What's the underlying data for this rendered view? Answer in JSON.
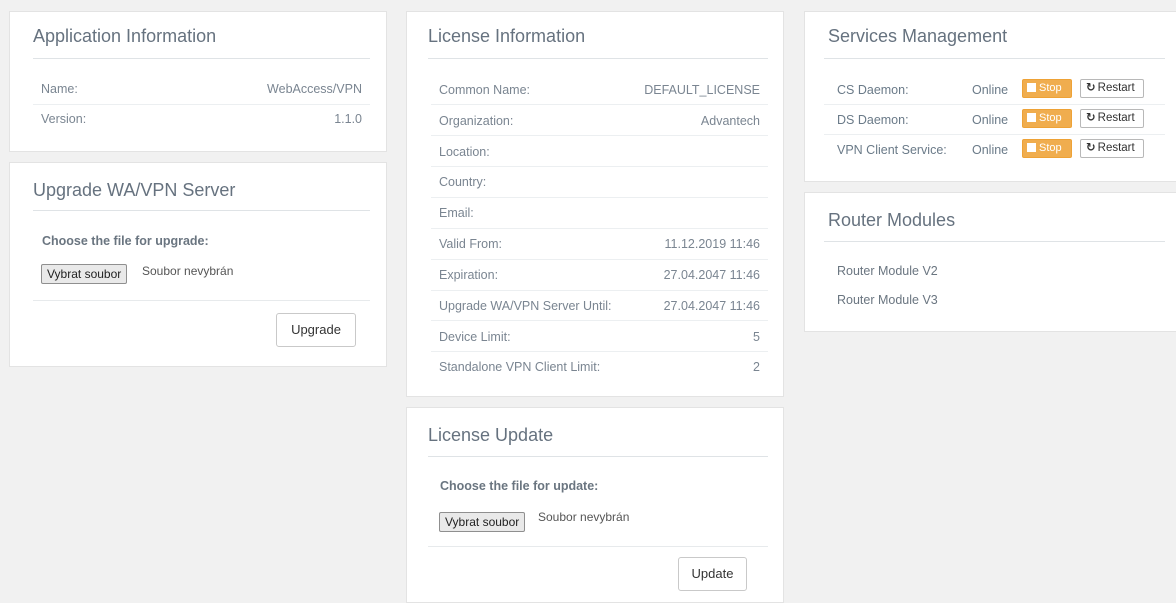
{
  "app_info": {
    "title": "Application Information",
    "rows": [
      {
        "label": "Name:",
        "value": "WebAccess/VPN"
      },
      {
        "label": "Version:",
        "value": "1.1.0"
      }
    ]
  },
  "upgrade": {
    "title": "Upgrade WA/VPN Server",
    "choose_label": "Choose the file for upgrade:",
    "file_button": "Vybrat soubor",
    "file_status": "Soubor nevybrán",
    "submit": "Upgrade"
  },
  "license_info": {
    "title": "License Information",
    "rows": [
      {
        "label": "Common Name:",
        "value": "DEFAULT_LICENSE"
      },
      {
        "label": "Organization:",
        "value": "Advantech"
      },
      {
        "label": "Location:",
        "value": ""
      },
      {
        "label": "Country:",
        "value": ""
      },
      {
        "label": "Email:",
        "value": ""
      },
      {
        "label": "Valid From:",
        "value": "11.12.2019 11:46"
      },
      {
        "label": "Expiration:",
        "value": "27.04.2047 11:46"
      },
      {
        "label": "Upgrade WA/VPN Server Until:",
        "value": "27.04.2047 11:46"
      },
      {
        "label": "Device Limit:",
        "value": "5"
      },
      {
        "label": "Standalone VPN Client Limit:",
        "value": "2"
      }
    ]
  },
  "license_update": {
    "title": "License Update",
    "choose_label": "Choose the file for update:",
    "file_button": "Vybrat soubor",
    "file_status": "Soubor nevybrán",
    "submit": "Update"
  },
  "services": {
    "title": "Services Management",
    "stop_label": "Stop",
    "restart_label": "Restart",
    "stop_color": "#f0ad4e",
    "items": [
      {
        "name": "CS Daemon:",
        "status": "Online"
      },
      {
        "name": "DS Daemon:",
        "status": "Online"
      },
      {
        "name": "VPN Client Service:",
        "status": "Online"
      }
    ]
  },
  "router_modules": {
    "title": "Router Modules",
    "items": [
      "Router Module V2",
      "Router Module V3"
    ]
  }
}
